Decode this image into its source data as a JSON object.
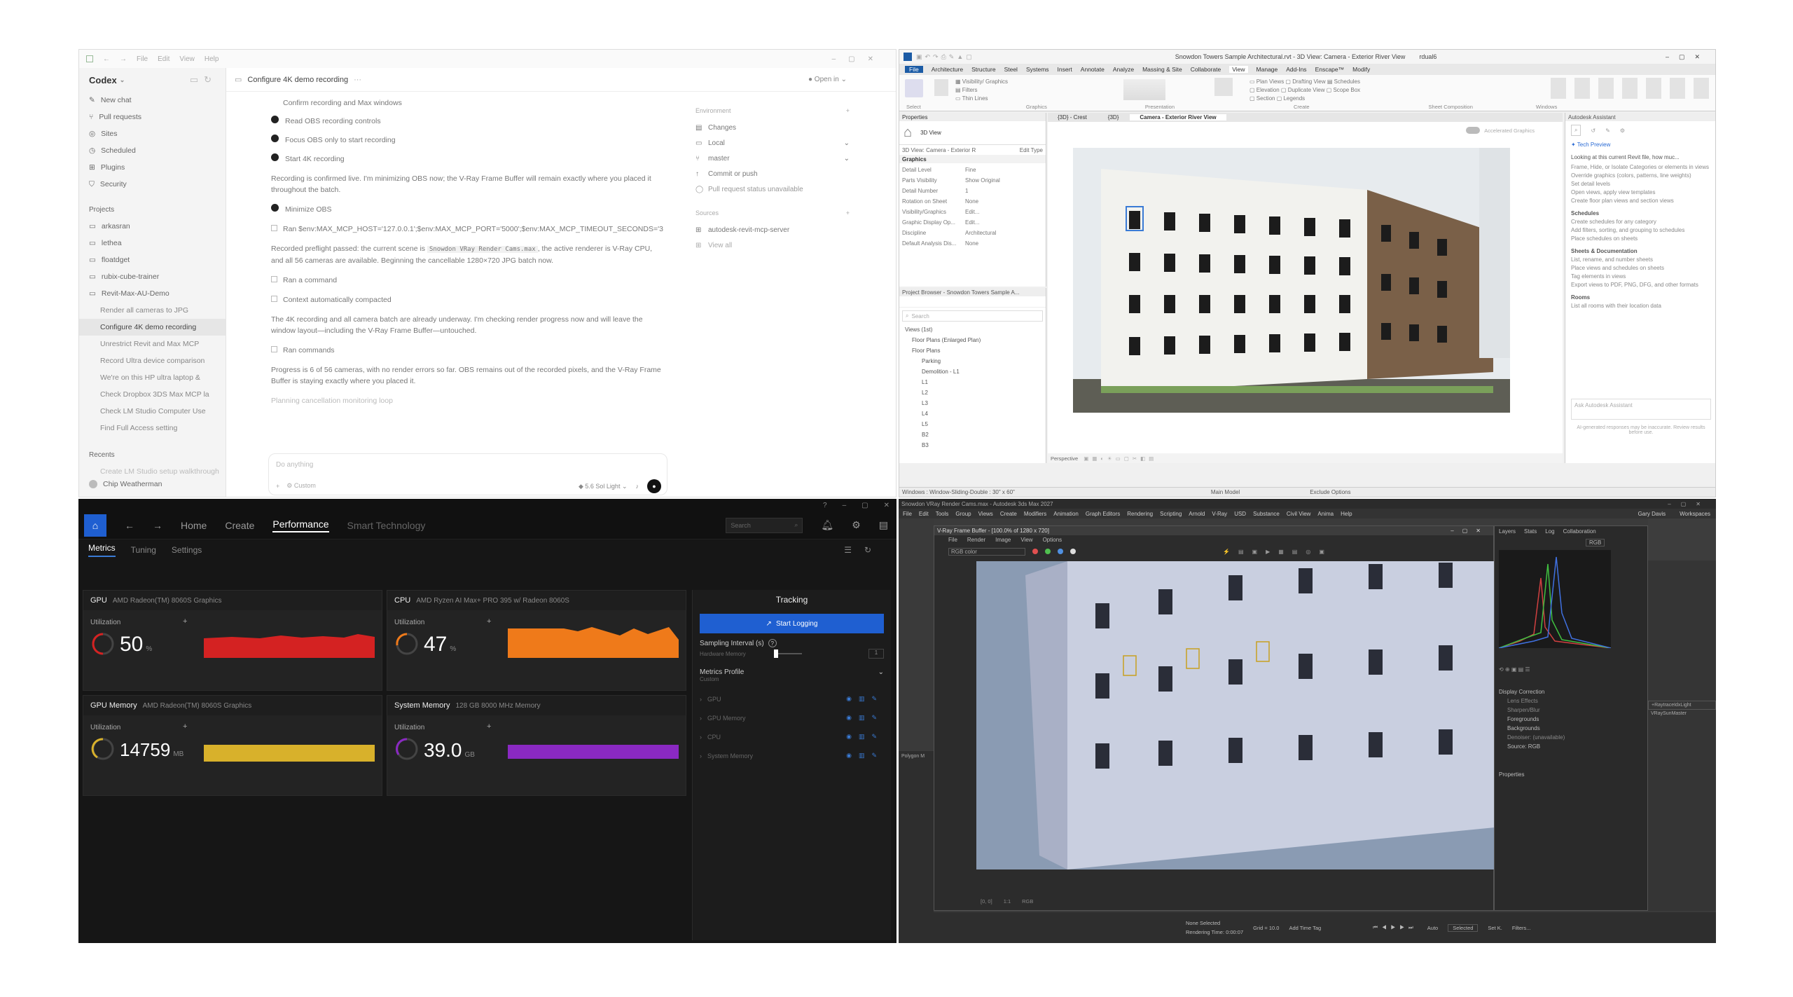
{
  "codex": {
    "menu": [
      "File",
      "Edit",
      "View",
      "Help"
    ],
    "app_name": "Codex",
    "nav": [
      "New chat",
      "Pull requests",
      "Sites",
      "Scheduled",
      "Plugins",
      "Security"
    ],
    "projects_label": "Projects",
    "projects": [
      "arkasran",
      "lethea",
      "floatdget",
      "rubix-cube-trainer",
      "Revit-Max-AU-Demo"
    ],
    "threads": [
      "Render all cameras to JPG",
      "Configure 4K demo recording",
      "Unrestrict Revit and Max MCP",
      "Record Ultra device comparison",
      "We're on this HP ultra laptop &",
      "Check Dropbox 3DS Max MCP la",
      "Check LM Studio Computer Use",
      "Find Full Access setting"
    ],
    "recents_label": "Recents",
    "recents_item": "Create LM Studio setup walkthrough",
    "user": "Chip Weatherman",
    "thread_title": "Configure 4K demo recording",
    "open_in": "Open in",
    "tasks": [
      "Confirm recording and Max windows",
      "Read OBS recording controls",
      "Focus OBS only to start recording",
      "Start 4K recording"
    ],
    "para1": "Recording is confirmed live. I'm minimizing OBS now; the V-Ray Frame Buffer will remain exactly where you placed it throughout the batch.",
    "task5": "Minimize OBS",
    "cmd_line": "Ran $env:MAX_MCP_HOST='127.0.0.1';$env:MAX_MCP_PORT='5000';$env:MAX_MCP_TIMEOUT_SECONDS='30'...",
    "para2_a": "Recorded preflight passed: the current scene is",
    "para2_code": "Snowdon VRay Render Cams.max",
    "para2_b": ", the active renderer is V-Ray CPU, and all 56 cameras are available. Beginning the cancellable 1280×720 JPG batch now.",
    "ran_command": "Ran a command",
    "compacted": "Context automatically compacted",
    "para3": "The 4K recording and all camera batch are already underway. I'm checking render progress now and will leave the window layout—including the V-Ray Frame Buffer—untouched.",
    "ran_commands": "Ran commands",
    "para4": "Progress is 6 of 56 cameras, with no render errors so far. OBS remains out of the recorded pixels, and the V-Ray Frame Buffer is staying exactly where you placed it.",
    "planning": "Planning cancellation monitoring loop",
    "input_placeholder": "Do anything",
    "custom": "Custom",
    "model": "5.6 Sol Light",
    "env_label": "Environment",
    "env_items": [
      "Changes",
      "Local",
      "master",
      "Commit or push",
      "Pull request status unavailable"
    ],
    "sources_label": "Sources",
    "sources_items": [
      "autodesk-revit-mcp-server",
      "View all"
    ]
  },
  "revit": {
    "title": "Snowdon Towers Sample Architectural.rvt - 3D View: Camera - Exterior River View",
    "user": "rdual6",
    "tabs": [
      "File",
      "Architecture",
      "Structure",
      "Steel",
      "Systems",
      "Insert",
      "Annotate",
      "Analyze",
      "Massing & Site",
      "Collaborate",
      "View",
      "Manage",
      "Add-Ins",
      "Enscape™",
      "Modify"
    ],
    "ribbon_groups": [
      "Select",
      "Graphics",
      "Presentation",
      "Create",
      "Sheet Composition",
      "Windows"
    ],
    "properties_title": "Properties",
    "view_type": "3D View",
    "prop_selector": "3D View: Camera - Exterior R",
    "edit_type": "Edit Type",
    "graphics_label": "Graphics",
    "props": [
      [
        "Detail Level",
        "Fine"
      ],
      [
        "Parts Visibility",
        "Show Original"
      ],
      [
        "Detail Number",
        "1"
      ],
      [
        "Rotation on Sheet",
        "None"
      ],
      [
        "Visibility/Graphics",
        "Edit..."
      ],
      [
        "Graphic Display Op...",
        "Edit..."
      ],
      [
        "Discipline",
        "Architectural"
      ],
      [
        "Default Analysis Dis...",
        "None"
      ]
    ],
    "view_tabs": [
      "{3D} - Crest",
      "{3D}",
      "Camera - Exterior River View"
    ],
    "accelerated": "Accelerated Graphics",
    "browser_title": "Project Browser - Snowdon Towers Sample A...",
    "search": "Search",
    "tree": [
      "Views (1st)",
      "Floor Plans (Enlarged Plan)",
      "Floor Plans",
      "Parking",
      "Demolition - L1",
      "L1",
      "L2",
      "L3",
      "L4",
      "L5",
      "B2",
      "B3"
    ],
    "view_scale": "Perspective",
    "status": "Windows : Window-Sliding-Double : 30\" x 60\"",
    "model": "Main Model",
    "exclude": "Exclude Options",
    "assistant_title": "Autodesk Assistant",
    "tech_preview": "Tech Preview",
    "assist_intro": "Looking at this current Revit file, how muc...",
    "assist_lines": [
      "Frame, Hide, or Isolate Categories or elements in views",
      "Override graphics (colors, patterns, line weights)",
      "Set detail levels",
      "Open views, apply view templates",
      "Create floor plan views and section views"
    ],
    "assist_schedules": "Schedules",
    "assist_sched_lines": [
      "Create schedules for any category",
      "Add filters, sorting, and grouping to schedules",
      "Place schedules on sheets"
    ],
    "assist_sheets": "Sheets & Documentation",
    "assist_sheet_lines": [
      "List, rename, and number sheets",
      "Place views and schedules on sheets",
      "Tag elements in views",
      "Export views to PDF, PNG, DFG, and other formats"
    ],
    "assist_rooms": "Rooms",
    "assist_room_line": "List all rooms with their location data",
    "ask_placeholder": "Ask Autodesk Assistant",
    "disclaimer": "AI-generated responses may be inaccurate. Review results before use."
  },
  "perf": {
    "nav": [
      "Home",
      "Create",
      "Performance",
      "Smart Technology"
    ],
    "search": "Search",
    "subnav": [
      "Metrics",
      "Tuning",
      "Settings"
    ],
    "gpu_title": "GPU",
    "gpu_name": "AMD Radeon(TM) 8060S Graphics",
    "cpu_title": "CPU",
    "cpu_name": "AMD Ryzen AI Max+ PRO 395 w/ Radeon 8060S",
    "gpumem_title": "GPU Memory",
    "gpumem_name": "AMD Radeon(TM) 8060S Graphics",
    "sysmem_title": "System Memory",
    "sysmem_name": "128 GB 8000 MHz Memory",
    "utilization": "Utilization",
    "gpu_value": "50",
    "gpu_unit": "%",
    "cpu_value": "47",
    "cpu_unit": "%",
    "gpumem_value": "14759",
    "gpumem_unit": "MB",
    "sysmem_value": "39.0",
    "sysmem_unit": "GB",
    "tracking": "Tracking",
    "start_logging": "Start Logging",
    "sampling": "Sampling Interval (s)",
    "hw_mem": "Hardware Memory",
    "sampling_value": "1",
    "profile": "Metrics Profile",
    "profile_value": "Custom",
    "profile_items": [
      "GPU",
      "GPU Memory",
      "CPU",
      "System Memory"
    ],
    "colors": {
      "gpu": "#d42222",
      "cpu": "#ef7a1a",
      "gpumem": "#d8b12b",
      "sysmem": "#8a29c2"
    }
  },
  "max": {
    "title": "Snowdon VRay Render Cams.max - Autodesk 3ds Max 2027",
    "menu": [
      "File",
      "Edit",
      "Tools",
      "Group",
      "Views",
      "Create",
      "Modifiers",
      "Animation",
      "Graph Editors",
      "Rendering",
      "Scripting",
      "Arnold",
      "V-Ray",
      "USD",
      "Substance",
      "Civil View",
      "Anima",
      "Help"
    ],
    "user": "Gary Davis",
    "workspaces": "Workspaces",
    "vfb_title": "V-Ray Frame Buffer - [100.0% of 1280 x 720]",
    "vfb_menu": [
      "File",
      "Render",
      "Image",
      "View",
      "Options"
    ],
    "vfb_channel": "RGB color",
    "layers_tabs": [
      "Layers",
      "Stats",
      "Log",
      "Collaboration"
    ],
    "histogram_channel": "RGB",
    "layer_items": [
      "Display Correction",
      "Lens Effects",
      "Sharpen/Blur",
      "Foregrounds",
      "Backgrounds",
      "Denoiser: (unavailable)",
      "Source: RGB"
    ],
    "properties": "Properties",
    "viewport_label": "Polygon M",
    "none_selected": "None Selected",
    "rendering_time": "Rendering Time: 0:00:07",
    "grid": "Grid = 10.0",
    "add_time_tag": "Add Time Tag",
    "auto": "Auto",
    "selected": "Selected",
    "set_k": "Set K.",
    "filters": "Filters...",
    "right_panel": [
      "+RaytraceIdxLight",
      "VRaySunMaster"
    ]
  }
}
